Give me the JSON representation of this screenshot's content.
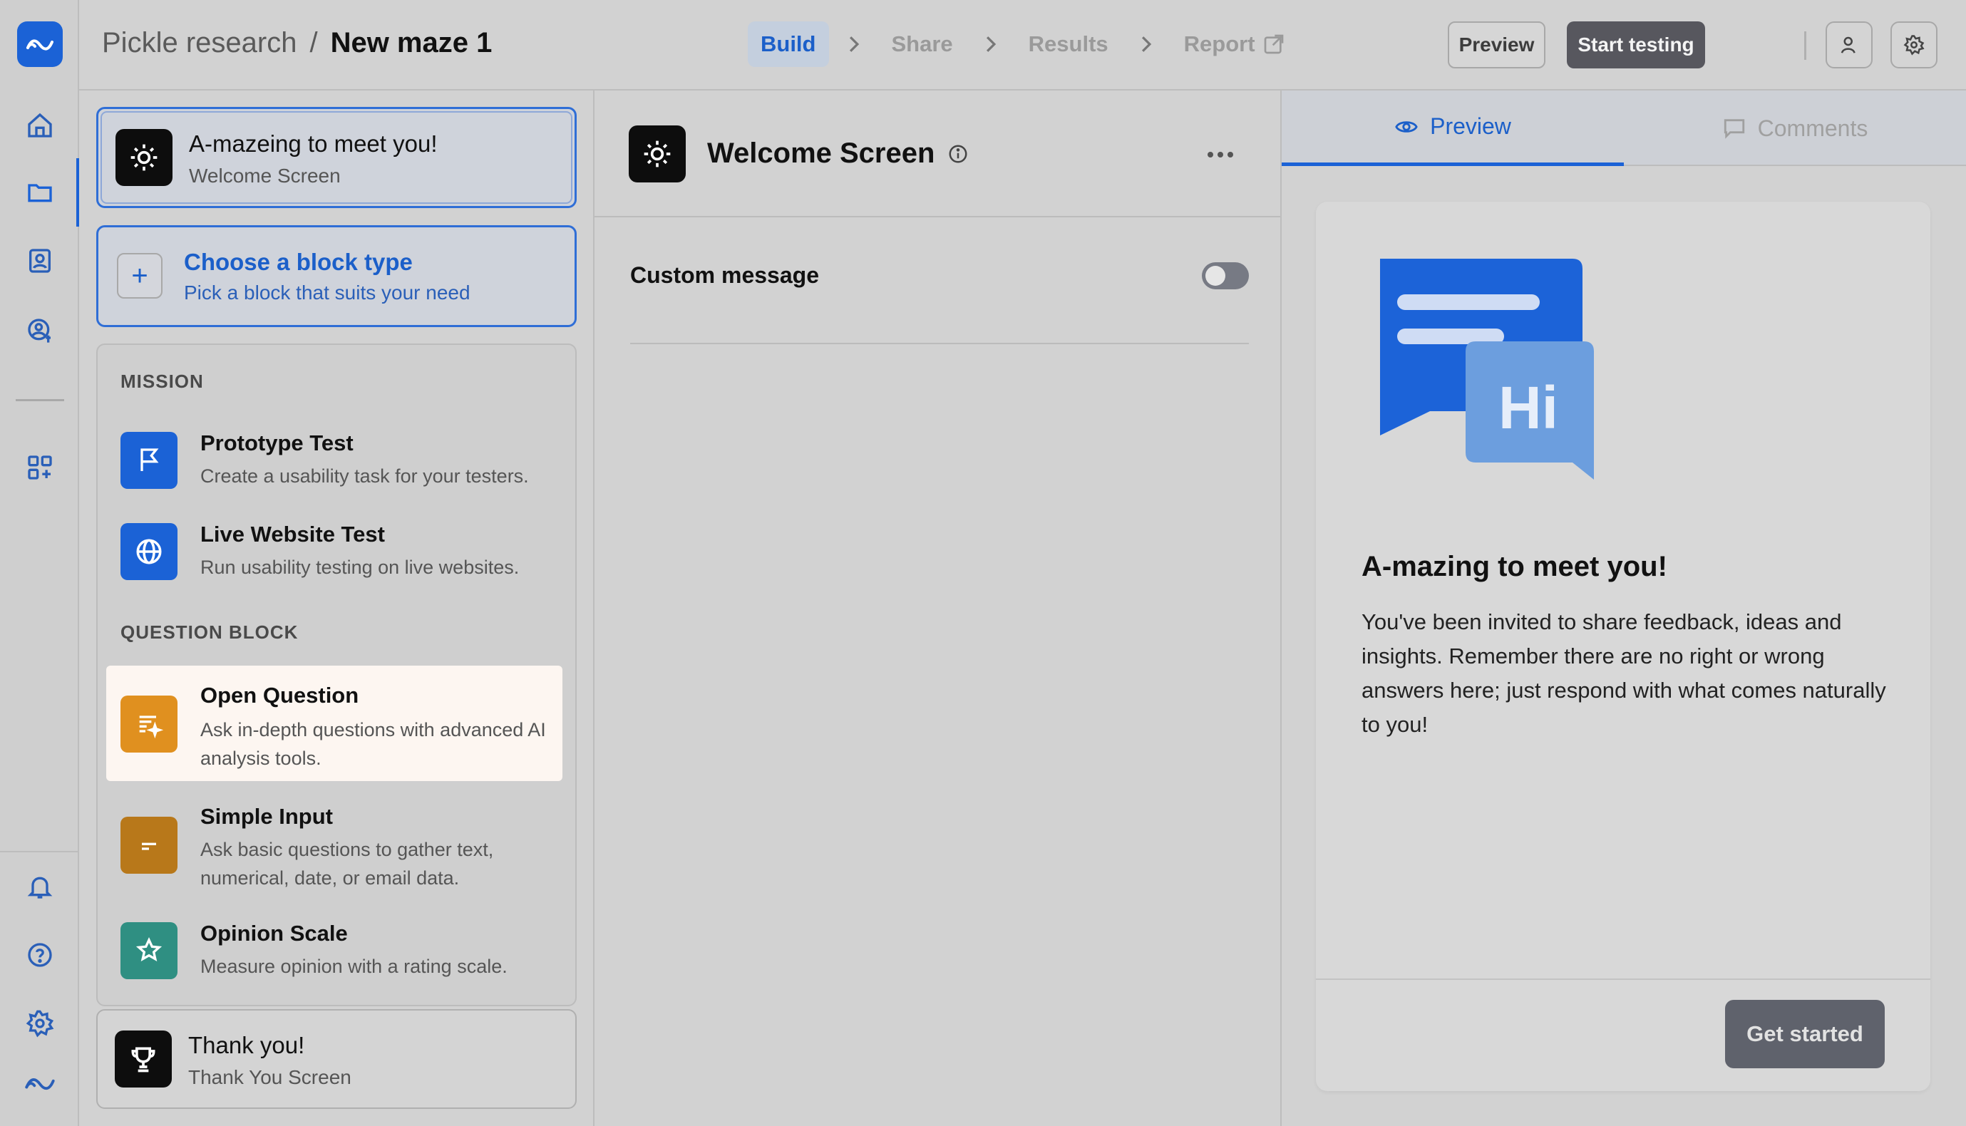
{
  "breadcrumb": {
    "project": "Pickle research",
    "separator": "/",
    "maze": "New maze 1"
  },
  "steps": [
    "Build",
    "Share",
    "Results",
    "Report"
  ],
  "toolbar": {
    "preview_label": "Preview",
    "start_label": "Start testing"
  },
  "blocks": {
    "welcome": {
      "title": "A-mazeing to meet you!",
      "subtitle": "Welcome Screen"
    },
    "choose": {
      "title": "Choose a block type",
      "subtitle": "Pick a block that suits your need"
    },
    "mission_header": "MISSION",
    "question_header": "QUESTION BLOCK",
    "items": [
      {
        "title": "Prototype Test",
        "desc": "Create a usability task for your testers."
      },
      {
        "title": "Live Website Test",
        "desc": "Run usability testing on live websites."
      },
      {
        "title": "Open Question",
        "desc": "Ask in-depth questions with advanced AI analysis tools."
      },
      {
        "title": "Simple Input",
        "desc": "Ask basic questions to gather text, numerical, date, or email data."
      },
      {
        "title": "Opinion Scale",
        "desc": "Measure opinion with a rating scale."
      }
    ],
    "thanks": {
      "title": "Thank you!",
      "subtitle": "Thank You Screen"
    }
  },
  "editor": {
    "title": "Welcome Screen",
    "custom_message_label": "Custom message",
    "custom_message_on": false
  },
  "right_panel": {
    "tabs": [
      "Preview",
      "Comments"
    ],
    "preview": {
      "title": "A-mazing to meet you!",
      "body": "You've been invited to share feedback, ideas and insights. Remember there are no right or wrong answers here; just respond with what comes naturally to you!",
      "button": "Get started",
      "illustration_text": "Hi"
    }
  },
  "colors": {
    "accent": "#1b62d6",
    "open_question": "#e0901f",
    "simple_input": "#b8781a",
    "opinion_scale": "#2f8f82"
  }
}
